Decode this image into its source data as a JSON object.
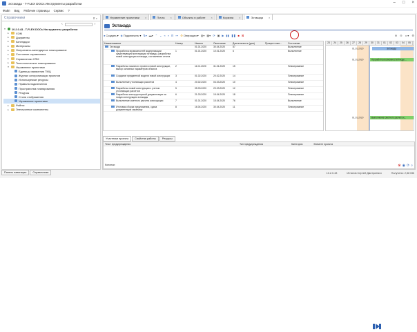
{
  "window": {
    "title": "Эстакада - T-FLEX DOCs Инструменты разработки"
  },
  "menu": [
    "Файл",
    "Вид",
    "Рабочие страницы",
    "Сервис",
    "?"
  ],
  "left_panel": {
    "title": "Справочники",
    "tree": [
      {
        "label": "10.2.0.43 - T-FLEX DOCs Инструменты разработки",
        "level": 0,
        "bold": true
      },
      {
        "label": "XOM",
        "level": 1
      },
      {
        "label": "Документы",
        "level": 1
      },
      {
        "label": "Календари",
        "level": 1
      },
      {
        "label": "Материалы",
        "level": 1
      },
      {
        "label": "Оперативно-календарное планирование",
        "level": 1
      },
      {
        "label": "Состояние справочника",
        "level": 1
      },
      {
        "label": "Справочники CRM",
        "level": 1
      },
      {
        "label": "Технологическое планирование",
        "level": 1
      },
      {
        "label": "Управление проектами",
        "level": 1,
        "open": true
      },
      {
        "label": "Единицы измерения ТМЦ",
        "level": 2
      },
      {
        "label": "Журнал синхронизации проектов",
        "level": 2
      },
      {
        "label": "Используемые ресурсы",
        "level": 2
      },
      {
        "label": "Правила подключения",
        "level": 2
      },
      {
        "label": "Пространства планирования",
        "level": 2
      },
      {
        "label": "Ресурсы",
        "level": 2
      },
      {
        "label": "Стили отображения",
        "level": 2
      },
      {
        "label": "Управление проектами",
        "level": 2,
        "selected": true
      },
      {
        "label": "Файлы",
        "level": 1
      },
      {
        "label": "Электронные компоненты",
        "level": 1
      }
    ],
    "tabs": [
      "Панель навигации",
      "Справочники"
    ]
  },
  "doc_tabs": [
    {
      "label": "Управление проектами",
      "active": false
    },
    {
      "label": "Почта",
      "active": false
    },
    {
      "label": "Объекты в работе",
      "active": false
    },
    {
      "label": "Корзина",
      "active": false
    },
    {
      "label": "Эстакада",
      "active": true
    }
  ],
  "header": {
    "title": "Эстакада"
  },
  "toolbar": {
    "create": "Создать",
    "connect": "Подключить",
    "operations": "Операции"
  },
  "grid": {
    "columns": [
      "Наименование",
      "Номер",
      "Начало",
      "Окончание",
      "Длительность (дни)",
      "Процент вып...",
      "Состояние"
    ],
    "rows": [
      {
        "name": "Эстакада",
        "num": "",
        "start": "01.01.2020",
        "end": "30.04.2020",
        "dur": "87",
        "pct": "",
        "state": "Выполнение"
      },
      {
        "name": "Проработка возможностей модернизации существующей конструкции эстакады, разработка новой конструкции эстакады, составление отчета",
        "num": "1",
        "start": "01.01.2020",
        "end": "10.01.2020",
        "dur": "6",
        "pct": "",
        "state": "Выполнение"
      },
      {
        "name": "Разработка эскизного проекта новой конструкции, выбор основных параметров объекта",
        "num": "2",
        "start": "11.01.2020",
        "end": "31.01.2020",
        "dur": "15",
        "pct": "",
        "state": "Планирование"
      },
      {
        "name": "Создание предметной модели новой конструкции",
        "num": "3",
        "start": "01.02.2020",
        "end": "20.02.2020",
        "dur": "14",
        "pct": "",
        "state": "Планирование"
      },
      {
        "name": "Выполнение уточняющих расчетов",
        "num": "4",
        "start": "20.02.2020",
        "end": "04.03.2020",
        "dur": "10",
        "pct": "",
        "state": "Планирование"
      },
      {
        "name": "Разработка новой конструкции с учетом уточняющих расчетов",
        "num": "5",
        "start": "05.03.2020",
        "end": "20.03.2020",
        "dur": "12",
        "pct": "",
        "state": "Планирование"
      },
      {
        "name": "Разработка конструкторской документации на новую конструкцию эстакады",
        "num": "6",
        "start": "21.03.2020",
        "end": "15.04.2020",
        "dur": "18",
        "pct": "",
        "state": "Планирование"
      },
      {
        "name": "Выполнение сметного расчета конструкции",
        "num": "7",
        "start": "01.01.2020",
        "end": "15.04.2020",
        "dur": "76",
        "pct": "",
        "state": "Выполнение"
      },
      {
        "name": "Итоговая сборка предложения, сдача документации заказчику",
        "num": "8",
        "start": "16.04.2020",
        "end": "30.04.2020",
        "dur": "11",
        "pct": "",
        "state": "Планирование"
      }
    ]
  },
  "gantt": {
    "days": [
      "23",
      "24",
      "25",
      "26",
      "27",
      "28",
      "29",
      "30",
      "31",
      "01",
      "02",
      "03",
      "04",
      "05"
    ],
    "bars": [
      {
        "label": "Эстакада",
        "date": "01.01.2020",
        "color": "#8fb6e6"
      },
      {
        "label": "Проработка возможностей моде...",
        "date": "01.01.2020",
        "color": "#7fd16a"
      },
      {
        "label": "Выполнение сметного расчета к...",
        "date": "01.01.2020",
        "color": "#7fd16a"
      }
    ]
  },
  "bottom_tabs": [
    "Участники проекта",
    "Свойства работы",
    "Ресурсы"
  ],
  "bottom_grid": {
    "columns": [
      "Текст предупреждения",
      "Тип предупреждения",
      "Категория",
      "Элемент проекта"
    ],
    "footer": "Колонки:"
  },
  "status": {
    "version": "10.2.0.43",
    "user": "Игнатов Сергей Дмитриевич",
    "memory": "Получено: 2,58 МБ"
  },
  "colors": {
    "accent": "#3c6fbf",
    "highlight": "#d01818"
  }
}
